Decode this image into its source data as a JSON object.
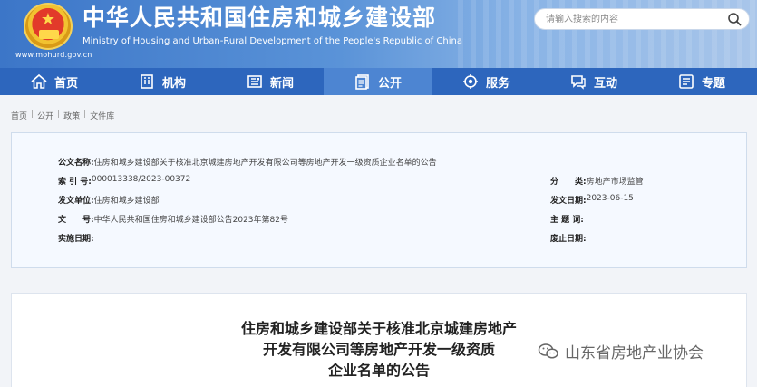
{
  "header": {
    "title_cn": "中华人民共和国住房和城乡建设部",
    "title_en": "Ministry of Housing and Urban-Rural Development of the People's Republic of China",
    "site_url": "www.mohurd.gov.cn",
    "search_placeholder": "请输入搜索的内容"
  },
  "nav": {
    "items": [
      {
        "label": "首页",
        "icon": "home-icon"
      },
      {
        "label": "机构",
        "icon": "building-icon"
      },
      {
        "label": "新闻",
        "icon": "newspaper-icon"
      },
      {
        "label": "公开",
        "icon": "document-icon",
        "active": true
      },
      {
        "label": "服务",
        "icon": "service-icon"
      },
      {
        "label": "互动",
        "icon": "chat-icon"
      },
      {
        "label": "专题",
        "icon": "topic-icon"
      }
    ]
  },
  "breadcrumb": [
    "首页",
    "公开",
    "政策",
    "文件库"
  ],
  "info": {
    "name_label": "公文名称:",
    "name_value": "住房和城乡建设部关于核准北京城建房地产开发有限公司等房地产开发一级资质企业名单的公告",
    "index_label": "索 引 号:",
    "index_value": "000013338/2023-00372",
    "category_label": "分　　类:",
    "category_value": "房地产市场监管",
    "issuer_label": "发文单位:",
    "issuer_value": "住房和城乡建设部",
    "date_label": "发文日期:",
    "date_value": "2023-06-15",
    "docno_label": "文　　号:",
    "docno_value": "中华人民共和国住房和城乡建设部公告2023年第82号",
    "subject_label": "主 题 词:",
    "subject_value": "",
    "effective_label": "实施日期:",
    "effective_value": "",
    "expiry_label": "废止日期:",
    "expiry_value": ""
  },
  "content": {
    "title_lines": [
      "住房和城乡建设部关于核准北京城建房地产",
      "开发有限公司等房地产开发一级资质",
      "企业名单的公告"
    ]
  },
  "watermark": {
    "text": "山东省房地产业协会"
  }
}
